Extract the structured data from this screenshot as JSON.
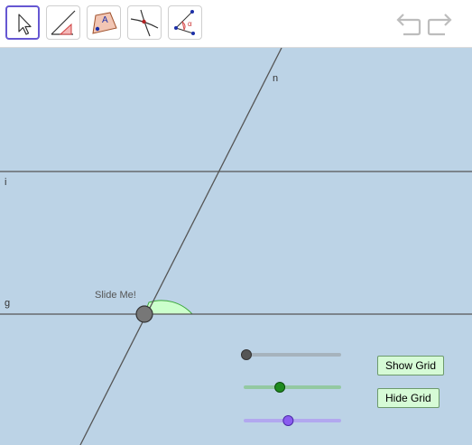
{
  "toolbar": {
    "tools": [
      {
        "name": "move-tool",
        "icon": "arrow-cursor-icon",
        "selected": true
      },
      {
        "name": "angle-tool",
        "icon": "triangle-angle-icon",
        "selected": false
      },
      {
        "name": "polygon-tool",
        "icon": "polygon-icon",
        "selected": false
      },
      {
        "name": "intersect-tool",
        "icon": "intersect-icon",
        "selected": false
      },
      {
        "name": "angle-measure-tool",
        "icon": "angle-measure-icon",
        "selected": false
      }
    ],
    "undo_icon": "undo-icon",
    "redo_icon": "redo-icon"
  },
  "canvas": {
    "lines": [
      {
        "name": "n",
        "label": "n"
      },
      {
        "name": "i",
        "label": "i"
      },
      {
        "name": "g",
        "label": "g"
      }
    ],
    "point_label": "Slide Me!",
    "sliders": [
      {
        "name": "slider-gray",
        "color": "#555555",
        "value": 0.0
      },
      {
        "name": "slider-green",
        "color": "#1f8b1f",
        "value": 0.36
      },
      {
        "name": "slider-purple",
        "color": "#8a5cf0",
        "value": 0.45
      }
    ],
    "buttons": {
      "show_grid": "Show Grid",
      "hide_grid": "Hide Grid"
    },
    "colors": {
      "background": "#bcd3e6",
      "angle_fill": "#ccffcc",
      "button_fill": "#d6fbd6"
    }
  }
}
